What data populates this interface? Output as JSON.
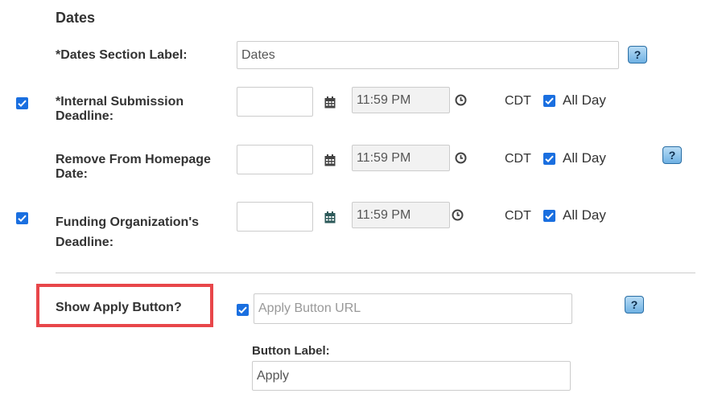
{
  "section": {
    "title": "Dates"
  },
  "dates_label": {
    "label": "*Dates Section Label:",
    "value": "Dates",
    "help": "?"
  },
  "rows": [
    {
      "label_line1": "*Internal Submission",
      "label_line2": "Deadline:",
      "time": "11:59 PM",
      "tz": "CDT",
      "all_day": "All Day"
    },
    {
      "label_line1": "Remove From Homepage",
      "label_line2": "Date:",
      "time": "11:59 PM",
      "tz": "CDT",
      "all_day": "All Day",
      "help": "?"
    },
    {
      "label_line1": "Funding Organization's",
      "label_line2": "Deadline:",
      "time": "11:59 PM",
      "tz": "CDT",
      "all_day": "All Day"
    }
  ],
  "apply": {
    "label": "Show Apply Button?",
    "url_placeholder": "Apply Button URL",
    "help": "?",
    "button_label_title": "Button Label:",
    "button_label_value": "Apply"
  },
  "colors": {
    "checkbox": "#1a6fe0",
    "highlight": "#e8464a",
    "help_button": "#6fb1e3"
  },
  "icons": [
    "calendar-icon",
    "clock-icon",
    "checkmark-icon",
    "help-icon"
  ]
}
